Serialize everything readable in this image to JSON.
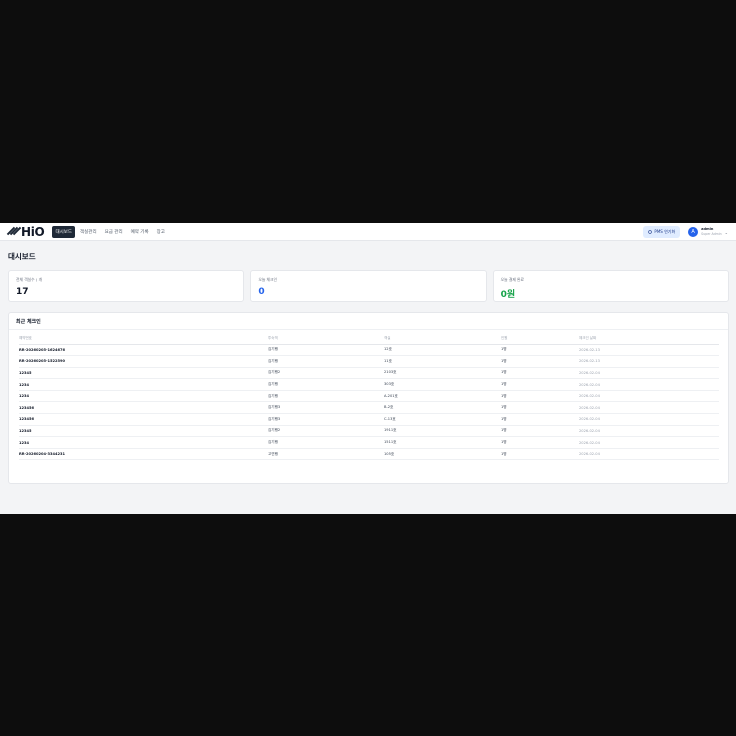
{
  "app": {
    "logo_text": "HiO"
  },
  "nav": {
    "items": [
      {
        "label": "대시보드",
        "active": true
      },
      {
        "label": "객실관리",
        "active": false
      },
      {
        "label": "요금 관리",
        "active": false
      },
      {
        "label": "예약 기록",
        "active": false
      },
      {
        "label": "장고",
        "active": false
      }
    ]
  },
  "header": {
    "pms_button_label": "PMS 연기화",
    "user_name": "admin",
    "user_role": "Super Admin",
    "avatar_initial": "A"
  },
  "page": {
    "title": "대시보드"
  },
  "stats": [
    {
      "label": "전체 객실수 ( 개",
      "value": "17",
      "color": "#111827"
    },
    {
      "label": "오늘 체크인",
      "value": "0",
      "color": "#2563eb"
    },
    {
      "label": "오늘 결제 완료",
      "value": "0원",
      "color": "#16a34a"
    }
  ],
  "recent_checkins": {
    "title": "최근 체크인",
    "columns": [
      "예약번호",
      "투숙객",
      "객실",
      "인원",
      "체크인 날짜"
    ],
    "rows": [
      [
        "RR-20260205-1624676",
        "김기행",
        "12호",
        "1명",
        "2026-02-13"
      ],
      [
        "RR-20260205-1522590",
        "김기행",
        "11호",
        "1명",
        "2026-02-13"
      ],
      [
        "12345",
        "김기행2",
        "2103호",
        "1명",
        "2026-02-04"
      ],
      [
        "1234",
        "김기행",
        "303호",
        "1명",
        "2026-02-04"
      ],
      [
        "1234",
        "김기행",
        "A-201호",
        "1명",
        "2026-02-04"
      ],
      [
        "123456",
        "김기행3",
        "B-2호",
        "1명",
        "2026-02-04"
      ],
      [
        "123456",
        "김기행3",
        "C-13호",
        "1명",
        "2026-02-04"
      ],
      [
        "12345",
        "김기행2",
        "1911호",
        "1명",
        "2026-02-04"
      ],
      [
        "1234",
        "김기행",
        "1511호",
        "1명",
        "2026-02-04"
      ],
      [
        "RR-20260204-3344231",
        "고연행",
        "105호",
        "1명",
        "2026-02-04"
      ]
    ]
  }
}
